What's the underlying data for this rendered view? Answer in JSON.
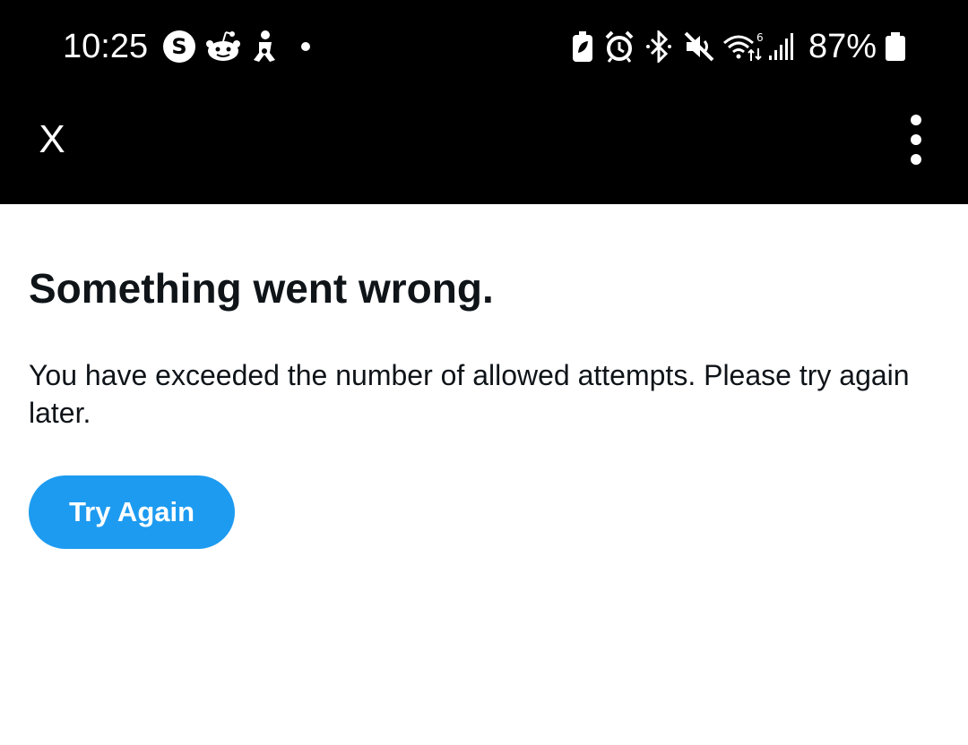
{
  "status_bar": {
    "time": "10:25",
    "battery_percent": "87%",
    "left_icons": [
      "threads-app-icon",
      "reddit-icon",
      "lifeguard-icon",
      "dot-notification-icon"
    ],
    "right_icons": [
      "battery-saver-icon",
      "alarm-icon",
      "bluetooth-icon",
      "mute-icon",
      "wifi-6-icon",
      "signal-bars-icon",
      "battery-icon"
    ]
  },
  "toolbar": {
    "close_label": "X",
    "more_icon": "more-vertical-icon"
  },
  "error": {
    "title": "Something went wrong.",
    "message": "You have exceeded the number of allowed attempts. Please try again later.",
    "button_label": "Try Again"
  },
  "colors": {
    "accent": "#1d9bf0",
    "text": "#0f1419",
    "top_bar": "#000000",
    "background": "#ffffff"
  }
}
